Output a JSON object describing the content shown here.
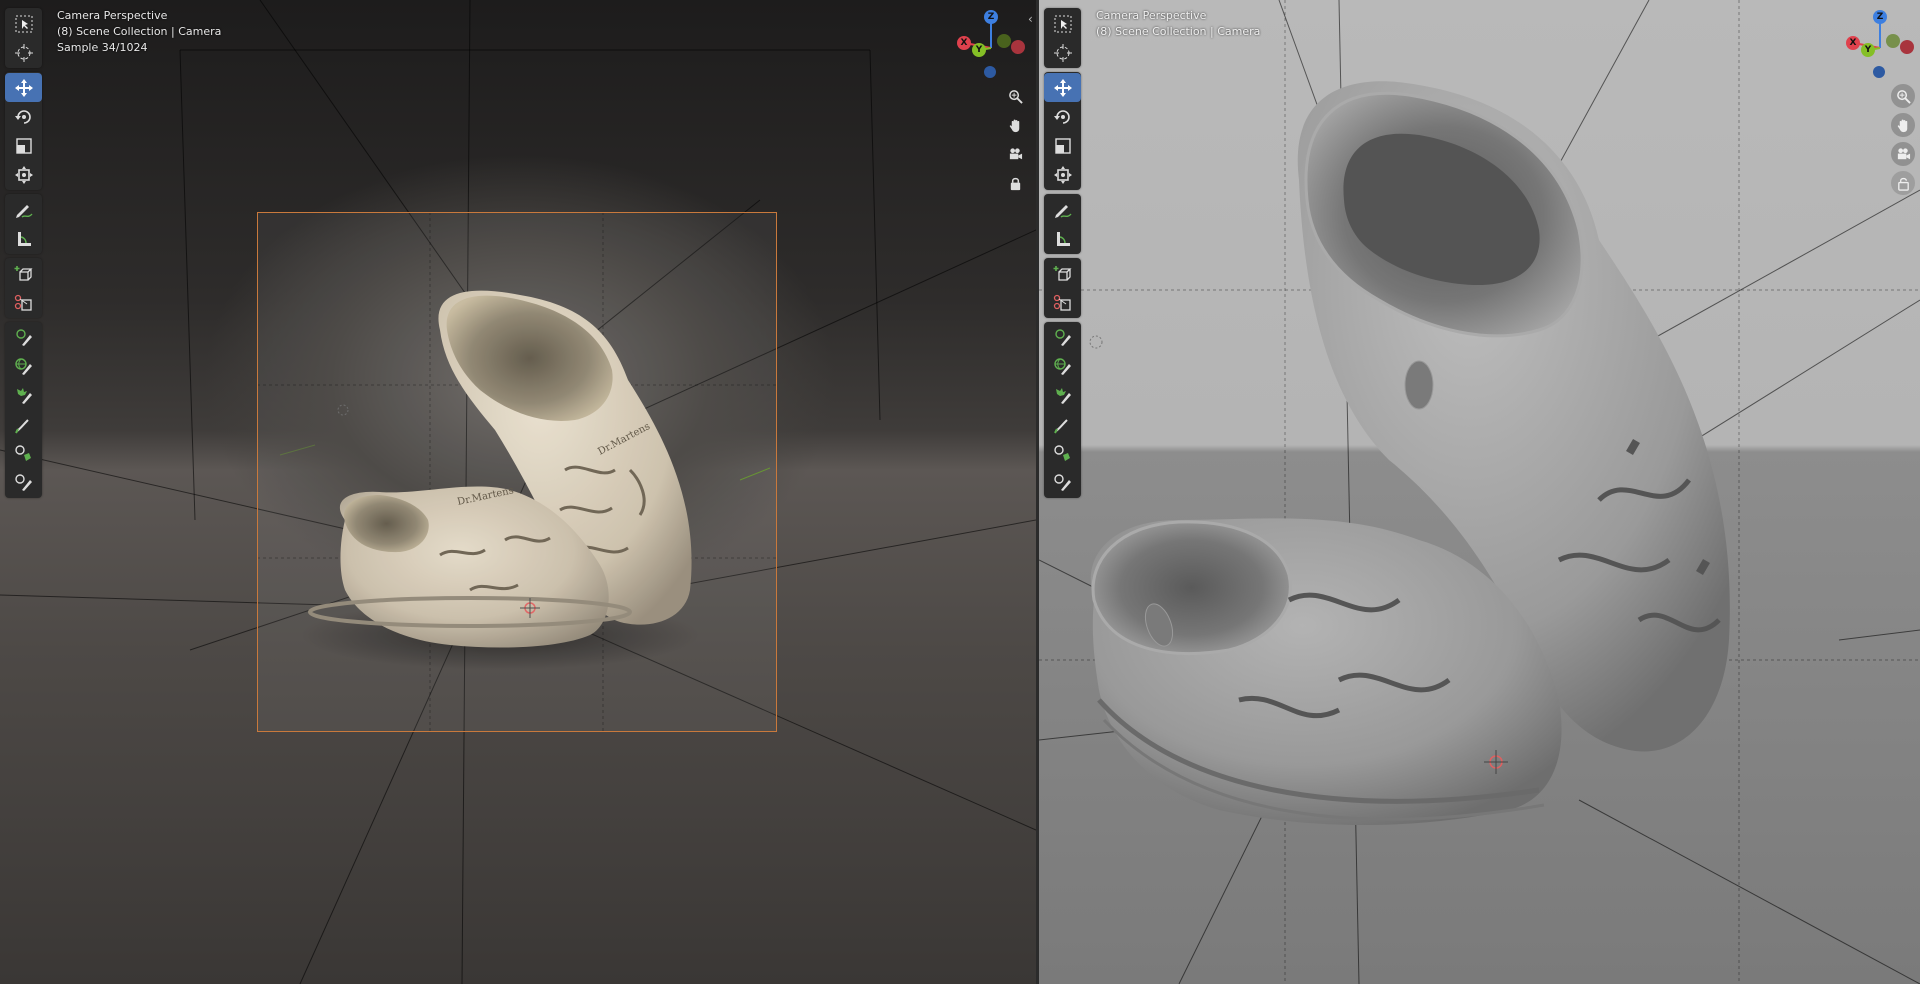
{
  "left_viewport": {
    "overlay": {
      "view_name": "Camera Perspective",
      "collection": "(8) Scene Collection | Camera",
      "samples": "Sample 34/1024"
    },
    "render_mode": "rendered",
    "brand_text": "Dr.Martens"
  },
  "right_viewport": {
    "overlay": {
      "view_name": "Camera Perspective",
      "collection": "(8) Scene Collection | Camera"
    },
    "render_mode": "solid"
  },
  "toolbar": {
    "tools": [
      {
        "name": "select-box-tool",
        "icon": "select-box-icon"
      },
      {
        "name": "cursor-tool",
        "icon": "cursor-icon"
      },
      {
        "name": "move-tool",
        "icon": "move-icon",
        "active": true
      },
      {
        "name": "rotate-tool",
        "icon": "rotate-icon"
      },
      {
        "name": "scale-tool",
        "icon": "scale-icon"
      },
      {
        "name": "transform-tool",
        "icon": "transform-icon"
      },
      {
        "name": "annotate-tool",
        "icon": "annotate-icon"
      },
      {
        "name": "measure-tool",
        "icon": "measure-icon"
      },
      {
        "name": "add-cube-tool",
        "icon": "add-cube-icon"
      },
      {
        "name": "cut-tool",
        "icon": "cut-icon"
      },
      {
        "name": "paint-tool-1",
        "icon": "brush-icon"
      },
      {
        "name": "paint-tool-2",
        "icon": "globe-brush-icon"
      },
      {
        "name": "paint-tool-3",
        "icon": "splash-brush-icon"
      },
      {
        "name": "paint-tool-4",
        "icon": "pen-icon"
      },
      {
        "name": "paint-tool-5",
        "icon": "eyedropper-icon"
      },
      {
        "name": "paint-tool-6",
        "icon": "knife-brush-icon"
      }
    ]
  },
  "gizmo": {
    "axes": {
      "x": "X",
      "y": "Y",
      "z": "Z"
    },
    "colors": {
      "x": "#e0414d",
      "y": "#85bf26",
      "z": "#3d7fe0",
      "neg_x": "#a8343d",
      "neg_y": "#5b7f1c",
      "neg_z": "#2d5aa2"
    }
  },
  "nav_buttons": [
    "zoom-icon",
    "pan-hand-icon",
    "camera-icon",
    "lock-icon"
  ],
  "colors": {
    "active_tool": "#4772b3",
    "camera_frame": "#c9793c",
    "toolbar_bg": "#2a2a2a"
  }
}
